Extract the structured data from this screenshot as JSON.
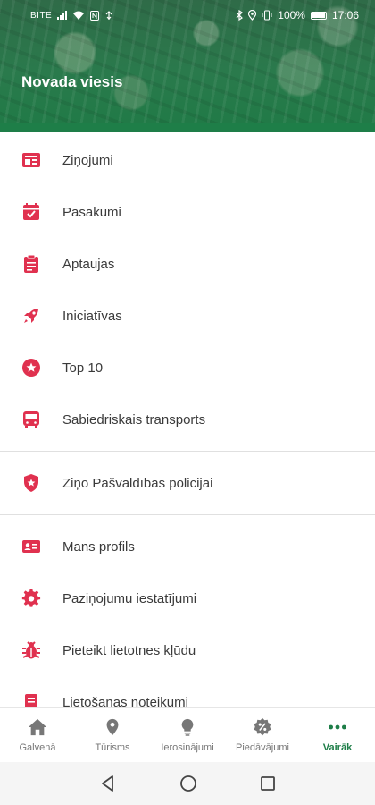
{
  "status_bar": {
    "carrier": "BITE",
    "battery": "100%",
    "time": "17:06"
  },
  "header": {
    "title": "Novada viesis"
  },
  "menu": {
    "items": [
      {
        "label": "Ziņojumi",
        "icon": "news-icon"
      },
      {
        "label": "Pasākumi",
        "icon": "calendar-check-icon"
      },
      {
        "label": "Aptaujas",
        "icon": "clipboard-icon"
      },
      {
        "label": "Iniciatīvas",
        "icon": "rocket-icon"
      },
      {
        "label": "Top 10",
        "icon": "star-circle-icon"
      },
      {
        "label": "Sabiedriskais transports",
        "icon": "bus-icon"
      }
    ],
    "secondary": [
      {
        "label": "Ziņo Pašvaldības policijai",
        "icon": "shield-star-icon"
      }
    ],
    "tertiary": [
      {
        "label": "Mans profils",
        "icon": "id-card-icon"
      },
      {
        "label": "Paziņojumu iestatījumi",
        "icon": "gear-icon"
      },
      {
        "label": "Pieteikt lietotnes kļūdu",
        "icon": "bug-icon"
      },
      {
        "label": "Lietošanas noteikumi",
        "icon": "document-icon"
      }
    ]
  },
  "bottom_nav": {
    "items": [
      {
        "label": "Galvenā",
        "icon": "home-icon"
      },
      {
        "label": "Tūrisms",
        "icon": "map-pin-icon"
      },
      {
        "label": "Ierosinājumi",
        "icon": "lightbulb-icon"
      },
      {
        "label": "Piedāvājumi",
        "icon": "percent-icon"
      },
      {
        "label": "Vairāk",
        "icon": "more-dots-icon"
      }
    ],
    "active_index": 4
  },
  "colors": {
    "accent": "#e0314f",
    "brand_green": "#1e7e48",
    "header_green": "#2a7a4c"
  }
}
